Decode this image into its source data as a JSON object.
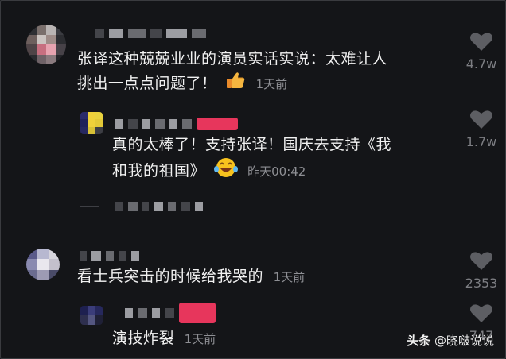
{
  "comments": [
    {
      "text_line1": "张译这种兢兢业业的演员实话实说：太难让人",
      "text_line2": "挑出一点点问题了！",
      "time": "1天前",
      "emoji": "thumbs-up-icon",
      "likes": "4.7w"
    },
    {
      "text_line1": "真的太棒了！支持张译！国庆去支持《我",
      "text_line2": "和我的祖国》",
      "time": "昨天00:42",
      "emoji": "laughing-face-icon",
      "likes": "1.7w"
    },
    {
      "text_line1": "看士兵突击的时候给我哭的",
      "time": "1天前",
      "likes": "2353"
    },
    {
      "text_line1": "演技炸裂",
      "time": "1天前",
      "likes": "747"
    }
  ],
  "watermark": {
    "brand": "头条",
    "account": "@晓啵说说"
  },
  "colors": {
    "background": "#141518",
    "text": "#f1f1f1",
    "muted": "#8e8f94",
    "heart": "#5d5e63",
    "pink": "#e7365c"
  }
}
